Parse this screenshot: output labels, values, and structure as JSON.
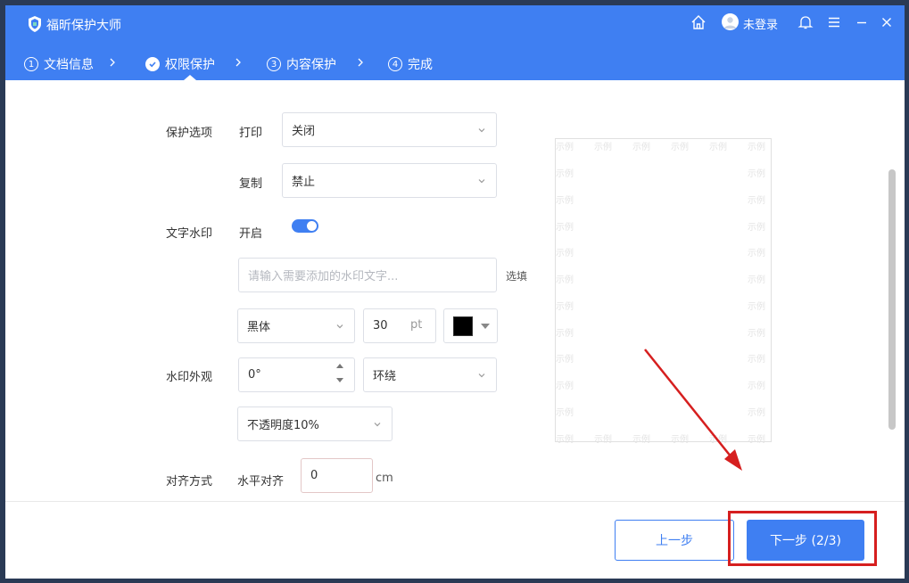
{
  "app": {
    "title": "福昕保护大师",
    "user": "未登录"
  },
  "steps": [
    {
      "num": "1",
      "label": "文档信息"
    },
    {
      "num": "",
      "label": "权限保护"
    },
    {
      "num": "3",
      "label": "内容保护"
    },
    {
      "num": "4",
      "label": "完成"
    }
  ],
  "protect": {
    "section": "保护选项",
    "print_label": "打印",
    "print_value": "关闭",
    "copy_label": "复制",
    "copy_value": "禁止"
  },
  "watermark": {
    "section": "文字水印",
    "enable_label": "开启",
    "enabled": true,
    "text_placeholder": "请输入需要添加的水印文字...",
    "optional_label": "选填",
    "font": "黑体",
    "size": "30",
    "size_unit": "pt",
    "color": "#000000"
  },
  "appearance": {
    "section": "水印外观",
    "rotation": "0°",
    "layout": "环绕",
    "opacity": "不透明度10%"
  },
  "align": {
    "section": "对齐方式",
    "horizontal_label": "水平对齐",
    "horizontal_value": "0",
    "unit": "cm"
  },
  "preview": {
    "watermark_text": "示例"
  },
  "footer": {
    "prev": "上一步",
    "next": "下一步 (2/3)"
  },
  "colors": {
    "brand": "#3f7ff2",
    "highlight": "#d61f1f"
  }
}
